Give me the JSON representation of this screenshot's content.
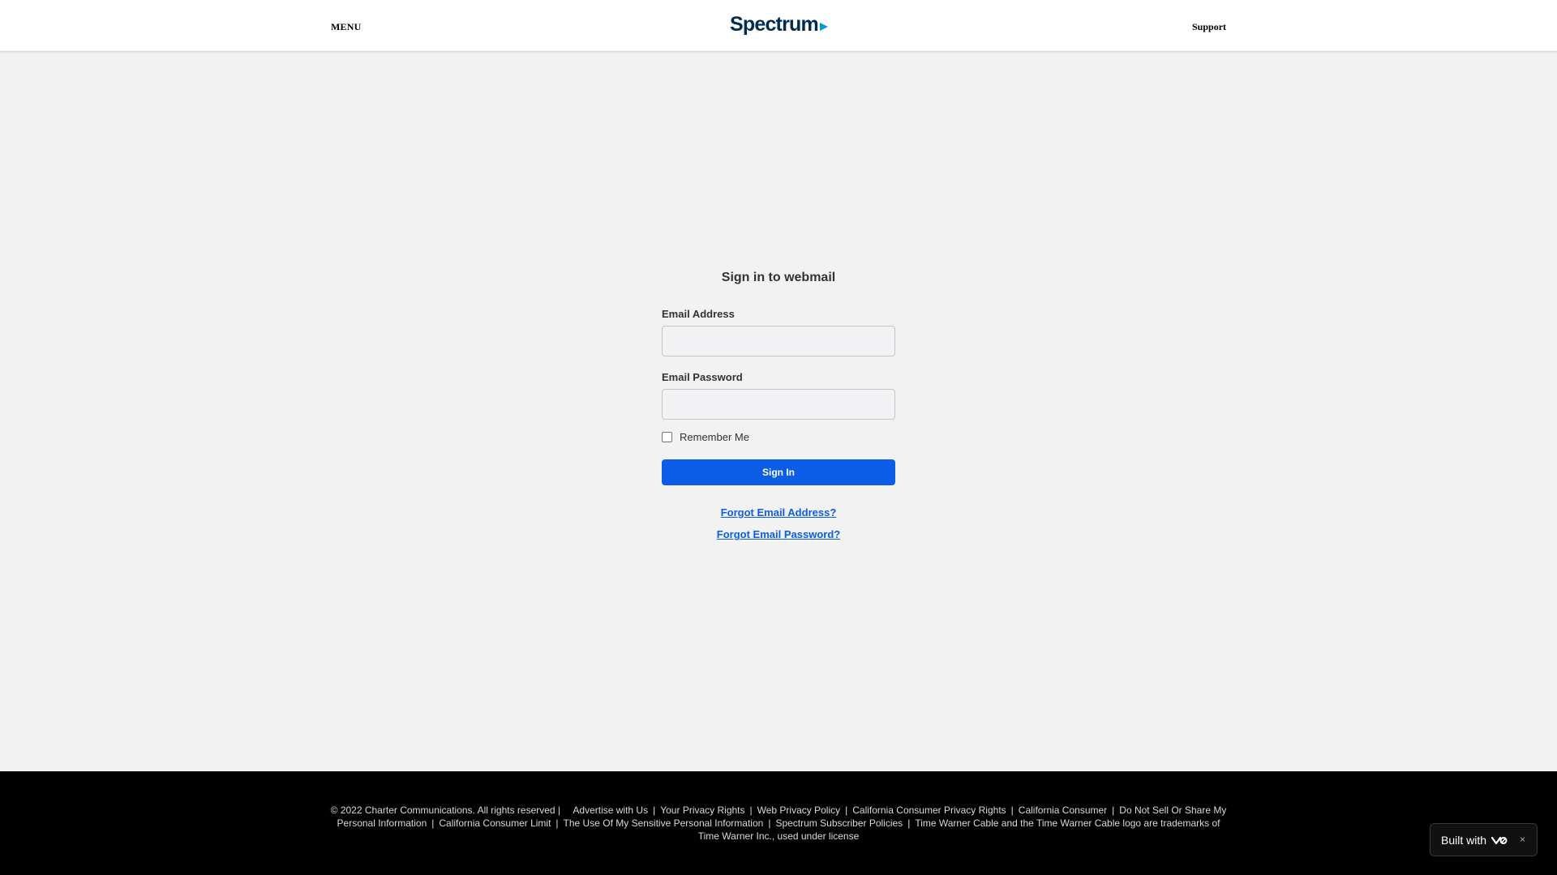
{
  "header": {
    "menu_label": "MENU",
    "logo_text": "Spectrum",
    "support_label": "Support"
  },
  "form": {
    "title": "Sign in to webmail",
    "email_label": "Email Address",
    "email_value": "",
    "password_label": "Email Password",
    "password_value": "",
    "remember_label": "Remember Me",
    "remember_checked": false,
    "signin_label": "Sign In",
    "forgot_email": "Forgot Email Address?",
    "forgot_password": "Forgot Email Password?"
  },
  "footer": {
    "copyright": "© 2022 Charter Communications. All rights reserved |",
    "links": [
      "Advertise with Us",
      "Your Privacy Rights",
      "Web Privacy Policy",
      "California Consumer Privacy Rights",
      "California Consumer",
      "Do Not Sell Or Share My Personal Information",
      "California Consumer Limit",
      "The Use Of My Sensitive Personal Information",
      "Spectrum Subscriber Policies"
    ],
    "trademark": "Time Warner Cable and the Time Warner Cable logo are trademarks of Time Warner Inc., used under license"
  },
  "badge": {
    "label": "Built with",
    "close_icon": "×"
  },
  "colors": {
    "brand_navy": "#002d4f",
    "brand_blue": "#0099d8",
    "primary_button": "#0b5de6",
    "page_background": "#f2f2f2",
    "footer_background": "#000000"
  },
  "icons": {
    "logo_arrow": "play-arrow-icon",
    "badge_logo": "vercel-style-logo-icon",
    "close": "close-icon"
  }
}
